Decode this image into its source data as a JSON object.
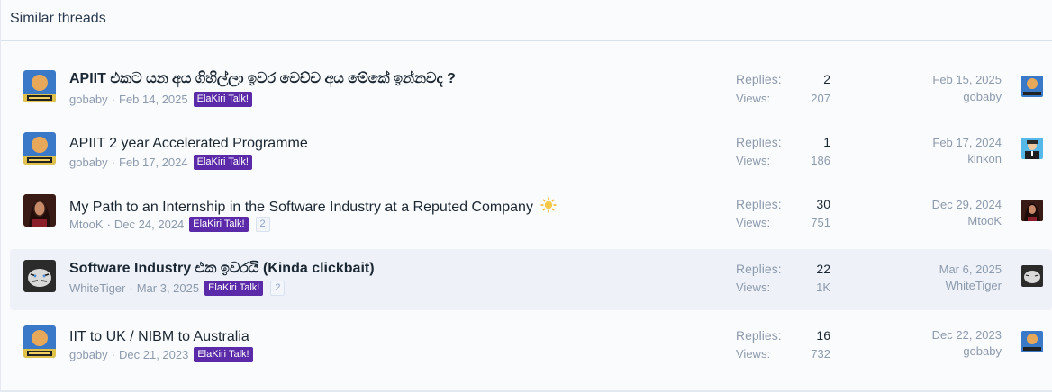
{
  "header": {
    "title": "Similar threads"
  },
  "labels": {
    "replies": "Replies:",
    "views": "Views:",
    "separator": "·"
  },
  "threads": [
    {
      "title": "APIIT එකට යන අය ගිහිල්ලා ඉවර වෙච්ච අය මේකේ ඉන්නවද ?",
      "author": "gobaby",
      "date": "Feb 14, 2025",
      "prefix": "ElaKiri Talk!",
      "pages": "",
      "replies": "2",
      "views": "207",
      "last_date": "Feb 15, 2025",
      "last_user": "gobaby"
    },
    {
      "title": "APIIT 2 year Accelerated Programme",
      "author": "gobaby",
      "date": "Feb 17, 2024",
      "prefix": "ElaKiri Talk!",
      "pages": "",
      "replies": "1",
      "views": "186",
      "last_date": "Feb 17, 2024",
      "last_user": "kinkon"
    },
    {
      "title": "My Path to an Internship in the Software Industry at a Reputed Company",
      "author": "MtooK",
      "date": "Dec 24, 2024",
      "prefix": "ElaKiri Talk!",
      "pages": "2",
      "replies": "30",
      "views": "751",
      "last_date": "Dec 29, 2024",
      "last_user": "MtooK"
    },
    {
      "title": "Software Industry එක ඉවරයි (Kinda clickbait)",
      "author": "WhiteTiger",
      "date": "Mar 3, 2025",
      "prefix": "ElaKiri Talk!",
      "pages": "2",
      "replies": "22",
      "views": "1K",
      "last_date": "Mar 6, 2025",
      "last_user": "WhiteTiger"
    },
    {
      "title": "IIT to UK / NIBM to Australia",
      "author": "gobaby",
      "date": "Dec 21, 2023",
      "prefix": "ElaKiri Talk!",
      "pages": "",
      "replies": "16",
      "views": "732",
      "last_date": "Dec 22, 2023",
      "last_user": "gobaby"
    }
  ],
  "colors": {
    "prefix_bg": "#5b2aa8",
    "highlight_row": "#eef2f8",
    "muted": "#8c9aad"
  }
}
